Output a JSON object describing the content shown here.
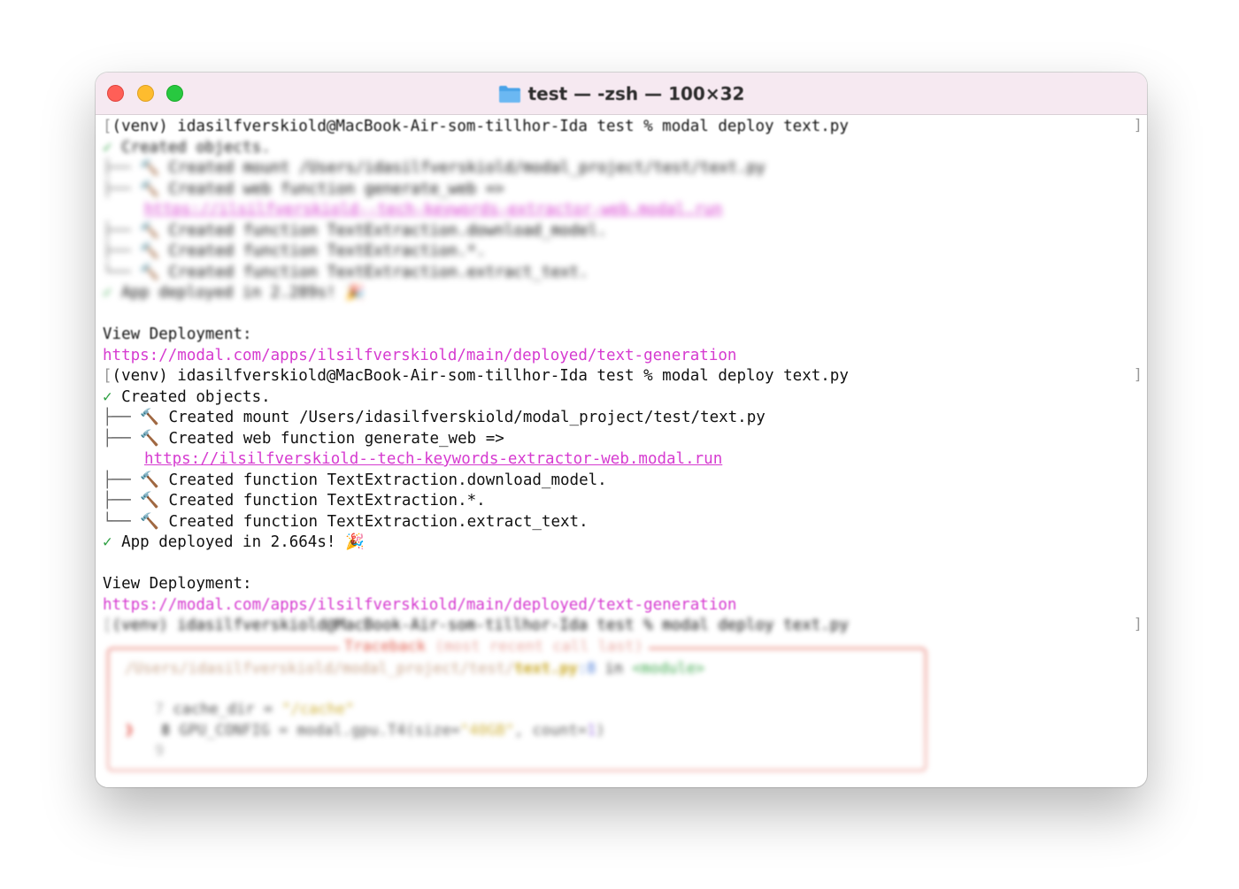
{
  "window": {
    "title": "test — -zsh — 100×32",
    "folder_icon": "folder-icon"
  },
  "terminal": {
    "prompt": "(venv) idasilfverskiold@MacBook-Air-som-tillhor-Ida test % modal deploy text.py",
    "created_objects": "Created objects.",
    "mount": "Created mount /Users/idasilfverskiold/modal_project/test/text.py",
    "web_function": "Created web function generate_web =>",
    "web_url": "https://ilsilfverskiold--tech-keywords-extractor-web.modal.run",
    "fn_download": "Created function TextExtraction.download_model.",
    "fn_star": "Created function TextExtraction.*.",
    "fn_extract": "Created function TextExtraction.extract_text.",
    "deployed_first": "App deployed in 2.289s!",
    "deployed": "App deployed in 2.664s!",
    "view_deployment": "View Deployment:",
    "deployment_url": "https://modal.com/apps/ilsilfverskiold/main/deployed/text-generation",
    "traceback_title": "Traceback",
    "traceback_sub": "(most recent call last)",
    "traceback_path": "/Users/idasilfverskiold/modal_project/test/",
    "traceback_file": "text.py",
    "traceback_lineno": ":8",
    "traceback_in": "in",
    "traceback_module": "<module>",
    "code_line7_no": "7",
    "code_line7_a": "cache_dir = ",
    "code_line7_b": "\"/cache\"",
    "code_line8_no": "8",
    "code_line8_a": "GPU_CONFIG = modal.gpu.T4(size=",
    "code_line8_b": "\"40GB\"",
    "code_line8_c": ", count=",
    "code_line8_d": "1",
    "code_line8_e": ")",
    "code_line9_no": "9",
    "arrow": "❱"
  }
}
